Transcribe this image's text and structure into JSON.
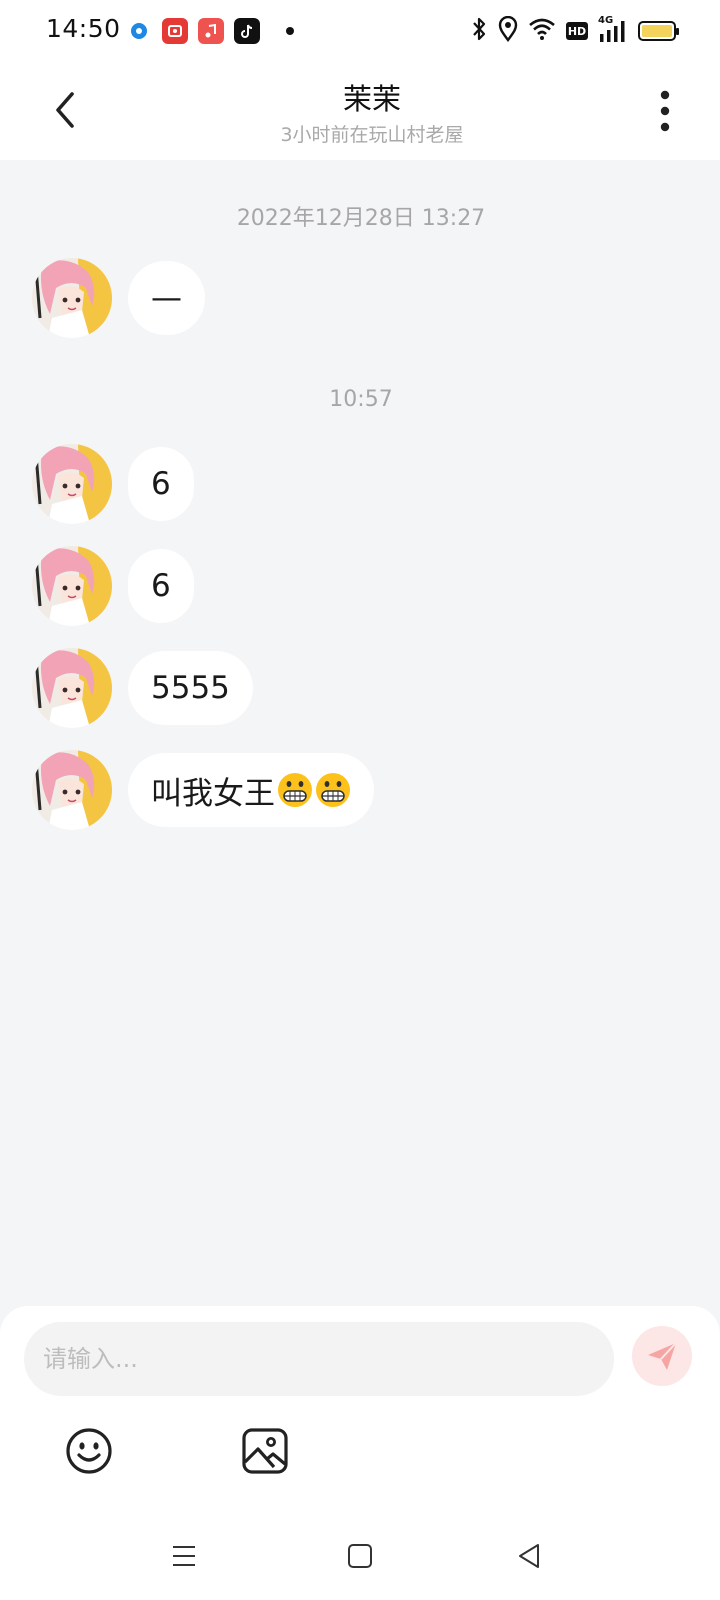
{
  "status_bar": {
    "time": "14:50",
    "apps": [
      "blue-circle-app-icon",
      "red-video-app-icon",
      "red-music-app-icon",
      "tiktok-app-icon"
    ],
    "network_label": "4G",
    "hd_label": "HD",
    "battery_color": "#f3d35c"
  },
  "header": {
    "title": "茉茉",
    "subtitle": "3小时前在玩山村老屋"
  },
  "chat": {
    "groups": [
      {
        "timestamp": "2022年12月28日 13:27",
        "messages": [
          {
            "text": "—"
          }
        ]
      },
      {
        "timestamp": "10:57",
        "messages": [
          {
            "text": "6"
          },
          {
            "text": "6"
          },
          {
            "text": "5555"
          },
          {
            "text": "叫我女王",
            "emoji": "grinning-face-emoji",
            "emoji_count": 2
          }
        ]
      }
    ]
  },
  "input": {
    "placeholder": "请输入..."
  },
  "toolbar": {
    "items": [
      "emoji-icon",
      "image-icon"
    ]
  },
  "colors": {
    "background": "#f4f5f7",
    "bubble": "#ffffff",
    "send_button": "#fde6e6",
    "send_icon": "#f6a5a5"
  }
}
